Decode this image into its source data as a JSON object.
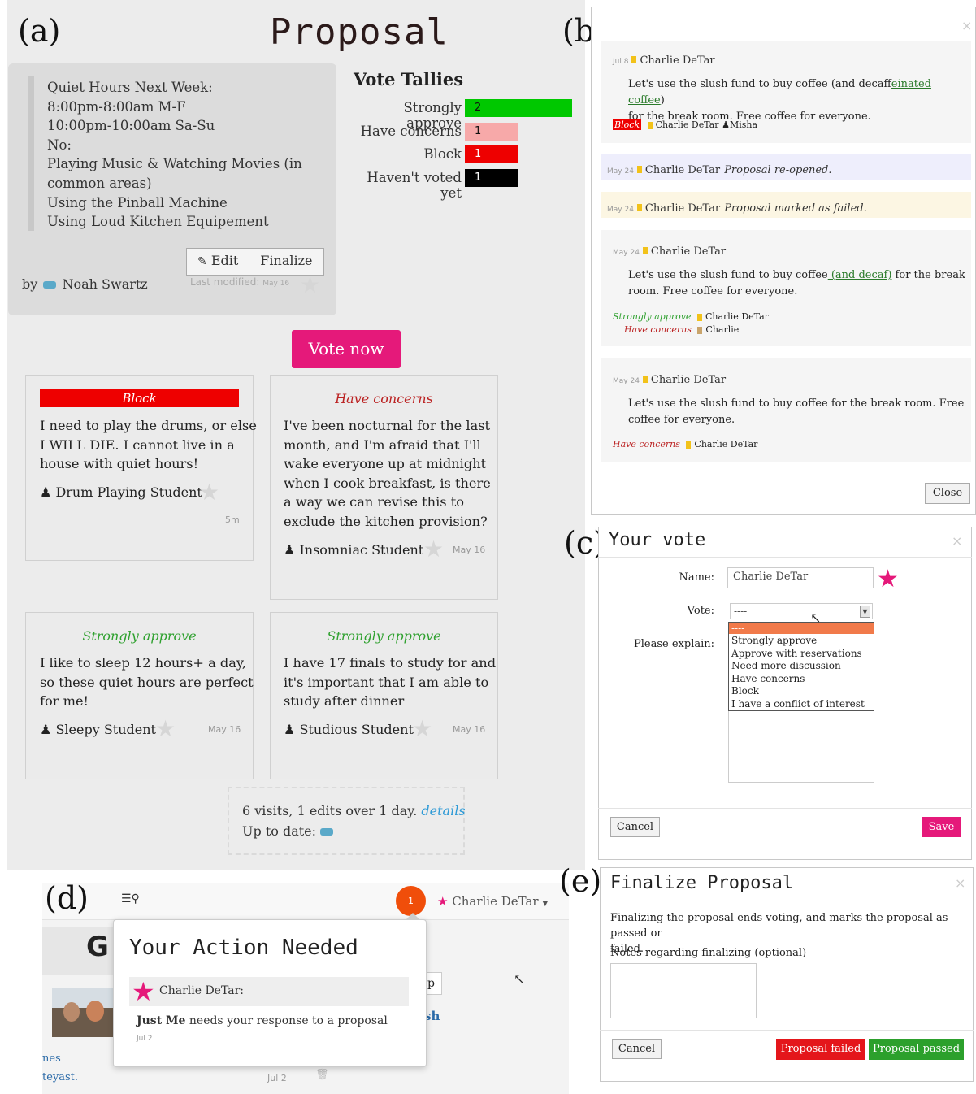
{
  "labels": {
    "a": "(a)",
    "b": "(b)",
    "c": "(c)",
    "d": "(d)",
    "e": "(e)"
  },
  "proposal": {
    "title": "Proposal",
    "lines": [
      "Quiet Hours Next Week:",
      "8:00pm-8:00am M-F",
      "10:00pm-10:00am Sa-Su",
      "No:",
      "Playing Music & Watching Movies (in",
      "common areas)",
      "Using the Pinball Machine",
      "Using Loud Kitchen Equipement"
    ],
    "edit_label": "Edit",
    "finalize_label": "Finalize",
    "by_label": "by",
    "author": "Noah Swartz",
    "last_modified_label": "Last modified:",
    "last_modified_date": "May 16"
  },
  "tallies": {
    "title": "Vote Tallies",
    "rows": [
      {
        "label": "Strongly approve",
        "count": "2",
        "value": 2,
        "color": "#00c800"
      },
      {
        "label": "Have concerns",
        "count": "1",
        "value": 1,
        "color": "#f7a9a9"
      },
      {
        "label": "Block",
        "count": "1",
        "value": 1,
        "color": "#ee0000"
      },
      {
        "label": "Haven't voted yet",
        "count": "1",
        "value": 1,
        "color": "#000000"
      }
    ]
  },
  "vote_now": "Vote now",
  "cards": [
    {
      "stance": "Block",
      "text": [
        "I need to play the drums, or else",
        "I WILL DIE. I cannot live in a",
        "house with quiet hours!"
      ],
      "author": "Drum Playing Student",
      "time": "5m"
    },
    {
      "stance": "Have concerns",
      "text": [
        "I've been nocturnal for the last",
        "month, and I'm afraid that I'll",
        "wake everyone up at midnight",
        "when I cook breakfast, is there",
        "a way we can revise this to",
        "exclude the kitchen provision?"
      ],
      "author": "Insomniac Student",
      "time": "May 16"
    },
    {
      "stance": "Strongly approve",
      "text": [
        "I like to sleep 12 hours+ a day,",
        "so these quiet hours are perfect",
        "for me!"
      ],
      "author": "Sleepy Student",
      "time": "May 16"
    },
    {
      "stance": "Strongly approve",
      "text": [
        "I have 17 finals to study for and",
        "it's important that I am able to",
        "study after dinner"
      ],
      "author": "Studious Student",
      "time": "May 16"
    }
  ],
  "stats": {
    "summary": "6 visits, 1 edits over 1 day.",
    "details": "details",
    "up_to_date": "Up to date:"
  },
  "history": {
    "entries": [
      {
        "date": "Jul 8",
        "name": "Charlie DeTar",
        "text_a": "Let's use the slush fund to buy coffee (and decaf",
        "text_a_ins": "feinated coffee",
        "text_a_end": ")",
        "text_b": "for the break room. Free coffee for everyone.",
        "vote": "Block",
        "voters": "Charlie DeTar",
        "voter2": "Misha"
      },
      {
        "date": "May 24",
        "name": "Charlie DeTar",
        "event": "Proposal re-opened."
      },
      {
        "date": "May 24",
        "name": "Charlie DeTar",
        "event": "Proposal marked as failed."
      },
      {
        "date": "May 24",
        "name": "Charlie DeTar",
        "text_a": "Let's use the slush fund to buy coffee",
        "text_a_ins": " (and decaf)",
        "text_a_end": " for the break",
        "text_b": "room. Free coffee for everyone.",
        "vote1": "Strongly approve",
        "voter1": "Charlie DeTar",
        "vote2": "Have concerns",
        "voter2": "Charlie"
      },
      {
        "date": "May 24",
        "name": "Charlie DeTar",
        "text_a": "Let's use the slush fund to buy coffee for the break room. Free",
        "text_b": "coffee for everyone.",
        "vote": "Have concerns",
        "voter": "Charlie DeTar"
      }
    ],
    "close_label": "Close"
  },
  "your_vote": {
    "title": "Your vote",
    "name_label": "Name:",
    "name_value": "Charlie DeTar",
    "vote_label": "Vote:",
    "vote_value": "----",
    "explain_label": "Please explain:",
    "options": [
      "----",
      "Strongly approve",
      "Approve with reservations",
      "Need more discussion",
      "Have concerns",
      "Block",
      "I have a conflict of interest"
    ],
    "cancel_label": "Cancel",
    "save_label": "Save"
  },
  "notifications": {
    "badge_count": "1",
    "user_name": "Charlie DeTar",
    "title": "Your Action Needed",
    "item_user": "Charlie DeTar:",
    "item_bold": "Just Me",
    "item_text": " needs your response to a proposal",
    "item_date": "Jul 2",
    "bg_heading": "G",
    "bg_btn": "p",
    "bg_link": "sh",
    "bg_text1": "nes",
    "bg_text2": "teyast.",
    "bg_date": "Jul 2"
  },
  "finalize": {
    "title": "Finalize Proposal",
    "desc": [
      "Finalizing the proposal ends voting, and marks the proposal as passed or",
      "failed."
    ],
    "notes_label": "Notes regarding finalizing (optional)",
    "cancel_label": "Cancel",
    "failed_label": "Proposal failed",
    "passed_label": "Proposal passed"
  },
  "colors": {
    "accent": "#e5197a",
    "star": "#e5197a",
    "badge": "#f04e0a",
    "failed": "#e4161b",
    "passed": "#2ca02c"
  }
}
